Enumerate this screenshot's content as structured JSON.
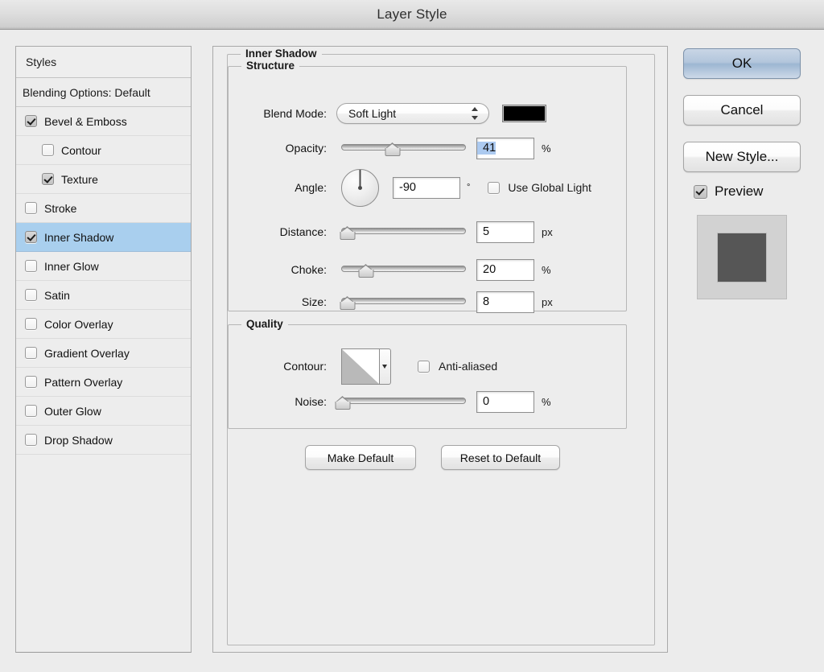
{
  "window": {
    "title": "Layer Style"
  },
  "sidebar": {
    "header": "Styles",
    "blending_options": "Blending Options: Default",
    "items": [
      {
        "label": "Bevel & Emboss",
        "checked": true,
        "indent": false,
        "selected": false
      },
      {
        "label": "Contour",
        "checked": false,
        "indent": true,
        "selected": false
      },
      {
        "label": "Texture",
        "checked": true,
        "indent": true,
        "selected": false
      },
      {
        "label": "Stroke",
        "checked": false,
        "indent": false,
        "selected": false
      },
      {
        "label": "Inner Shadow",
        "checked": true,
        "indent": false,
        "selected": true
      },
      {
        "label": "Inner Glow",
        "checked": false,
        "indent": false,
        "selected": false
      },
      {
        "label": "Satin",
        "checked": false,
        "indent": false,
        "selected": false
      },
      {
        "label": "Color Overlay",
        "checked": false,
        "indent": false,
        "selected": false
      },
      {
        "label": "Gradient Overlay",
        "checked": false,
        "indent": false,
        "selected": false
      },
      {
        "label": "Pattern Overlay",
        "checked": false,
        "indent": false,
        "selected": false
      },
      {
        "label": "Outer Glow",
        "checked": false,
        "indent": false,
        "selected": false
      },
      {
        "label": "Drop Shadow",
        "checked": false,
        "indent": false,
        "selected": false
      }
    ],
    "selection_color": "#a9cfee"
  },
  "main": {
    "group_title": "Inner Shadow",
    "structure": {
      "title": "Structure",
      "blend_mode": {
        "label": "Blend Mode:",
        "value": "Soft Light"
      },
      "color": {
        "swatch_color": "#000000"
      },
      "opacity": {
        "label": "Opacity:",
        "value": "41",
        "unit": "%",
        "percent": 41,
        "selected": true
      },
      "angle": {
        "label": "Angle:",
        "value": "-90",
        "unit": "°",
        "degrees": -90,
        "use_global_light_label": "Use Global Light",
        "use_global_light_checked": false
      },
      "distance": {
        "label": "Distance:",
        "value": "5",
        "unit": "px",
        "percent": 3
      },
      "choke": {
        "label": "Choke:",
        "value": "20",
        "unit": "%",
        "percent": 20
      },
      "size": {
        "label": "Size:",
        "value": "8",
        "unit": "px",
        "percent": 3
      }
    },
    "quality": {
      "title": "Quality",
      "contour": {
        "label": "Contour:",
        "anti_aliased_label": "Anti-aliased",
        "anti_aliased_checked": false
      },
      "noise": {
        "label": "Noise:",
        "value": "0",
        "unit": "%",
        "percent": 0
      }
    },
    "buttons": {
      "make_default": "Make Default",
      "reset_to_default": "Reset to Default"
    }
  },
  "actions": {
    "ok": "OK",
    "cancel": "Cancel",
    "new_style": "New Style...",
    "preview_label": "Preview",
    "preview_checked": true
  }
}
